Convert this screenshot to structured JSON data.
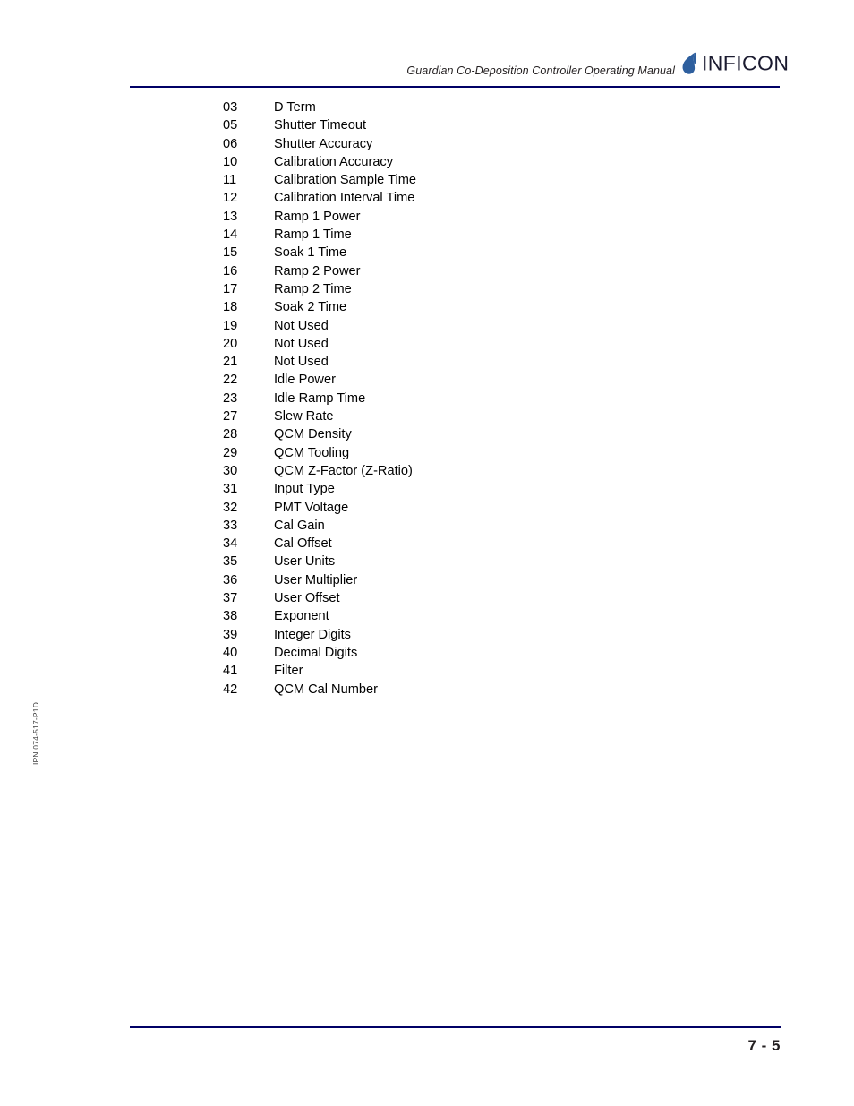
{
  "header": {
    "title": "Guardian Co-Deposition Controller Operating Manual",
    "logo_word": "INFICON",
    "logo_mark_icon": "inficon-droplet-icon",
    "rule_color": "#000066"
  },
  "side_code": "IPN 074-517-P1D",
  "content": {
    "rows": [
      {
        "num": "03",
        "label": "D Term"
      },
      {
        "num": "05",
        "label": "Shutter Timeout"
      },
      {
        "num": "06",
        "label": "Shutter Accuracy"
      },
      {
        "num": "10",
        "label": "Calibration Accuracy"
      },
      {
        "num": "11",
        "label": "Calibration Sample Time"
      },
      {
        "num": "12",
        "label": "Calibration Interval Time"
      },
      {
        "num": "13",
        "label": "Ramp 1 Power"
      },
      {
        "num": "14",
        "label": "Ramp 1 Time"
      },
      {
        "num": "15",
        "label": "Soak 1 Time"
      },
      {
        "num": "16",
        "label": "Ramp 2 Power"
      },
      {
        "num": "17",
        "label": "Ramp 2 Time"
      },
      {
        "num": "18",
        "label": "Soak 2 Time"
      },
      {
        "num": "19",
        "label": "Not Used"
      },
      {
        "num": "20",
        "label": "Not Used"
      },
      {
        "num": "21",
        "label": "Not Used"
      },
      {
        "num": "22",
        "label": "Idle Power"
      },
      {
        "num": "23",
        "label": "Idle Ramp Time"
      },
      {
        "num": "27",
        "label": "Slew Rate"
      },
      {
        "num": "28",
        "label": "QCM Density"
      },
      {
        "num": "29",
        "label": "QCM Tooling"
      },
      {
        "num": "30",
        "label": "QCM Z-Factor (Z-Ratio)"
      },
      {
        "num": "31",
        "label": "Input Type"
      },
      {
        "num": "32",
        "label": "PMT Voltage"
      },
      {
        "num": "33",
        "label": "Cal Gain"
      },
      {
        "num": "34",
        "label": "Cal Offset"
      },
      {
        "num": "35",
        "label": "User Units"
      },
      {
        "num": "36",
        "label": "User Multiplier"
      },
      {
        "num": "37",
        "label": "User Offset"
      },
      {
        "num": "38",
        "label": "Exponent"
      },
      {
        "num": "39",
        "label": "Integer Digits"
      },
      {
        "num": "40",
        "label": "Decimal Digits"
      },
      {
        "num": "41",
        "label": "Filter"
      },
      {
        "num": "42",
        "label": "QCM Cal Number"
      }
    ]
  },
  "footer": {
    "page_number": "7 - 5",
    "rule_color": "#000066"
  },
  "colors": {
    "rule_navy": "#000066",
    "logo_blue": "#2e5f9e",
    "text_black": "#000000",
    "text_dark": "#231f20",
    "page_background": "#ffffff"
  }
}
